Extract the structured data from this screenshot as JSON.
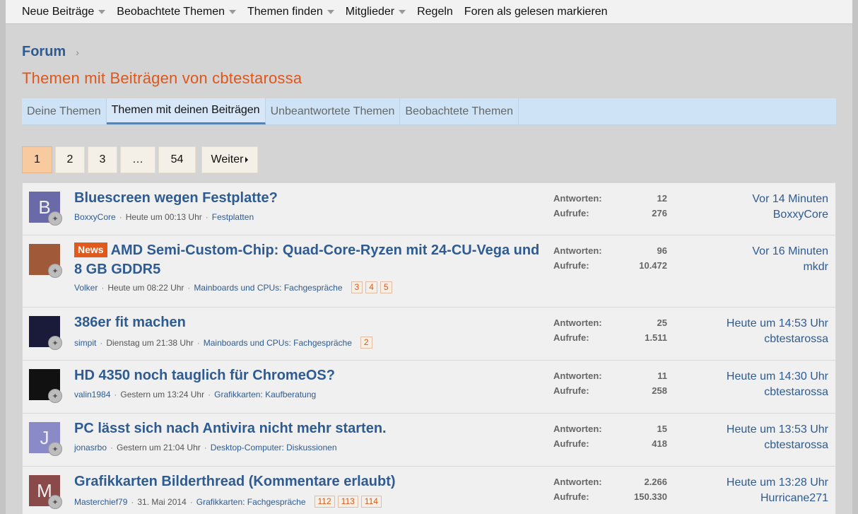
{
  "nav": {
    "items": [
      {
        "label": "Neue Beiträge",
        "caret": true
      },
      {
        "label": "Beobachtete Themen",
        "caret": true
      },
      {
        "label": "Themen finden",
        "caret": true
      },
      {
        "label": "Mitglieder",
        "caret": true
      },
      {
        "label": "Regeln",
        "caret": false
      },
      {
        "label": "Foren als gelesen markieren",
        "caret": false
      }
    ]
  },
  "breadcrumb": {
    "root": "Forum",
    "separator": "›"
  },
  "page_title": "Themen mit Beiträgen von cbtestarossa",
  "tabs": [
    {
      "label": "Deine Themen",
      "active": false
    },
    {
      "label": "Themen mit deinen Beiträgen",
      "active": true
    },
    {
      "label": "Unbeantwortete Themen",
      "active": false
    },
    {
      "label": "Beobachtete Themen",
      "active": false
    }
  ],
  "pagination": {
    "pages": [
      "1",
      "2",
      "3",
      "…",
      "54"
    ],
    "current": "1",
    "next_label": "Weiter"
  },
  "labels": {
    "replies": "Antworten:",
    "views": "Aufrufe:"
  },
  "threads": [
    {
      "title": "Bluescreen wegen Festplatte?",
      "prefix": "",
      "avatar_letter": "B",
      "avatar_color": "#6a6aa8",
      "author": "BoxxyCore",
      "date": "Heute um 00:13 Uhr",
      "forum": "Festplatten",
      "pages": [],
      "replies": "12",
      "views": "276",
      "last_time": "Vor 14 Minuten",
      "last_user": "BoxxyCore"
    },
    {
      "title": "AMD Semi-Custom-Chip: Quad-Core-Ryzen mit 24-CU-Vega und 8 GB GDDR5",
      "prefix": "News",
      "avatar_letter": "",
      "avatar_color": "#a05a3a",
      "author": "Volker",
      "date": "Heute um 08:22 Uhr",
      "forum": "Mainboards und CPUs: Fachgespräche",
      "pages": [
        "3",
        "4",
        "5"
      ],
      "replies": "96",
      "views": "10.472",
      "last_time": "Vor 16 Minuten",
      "last_user": "mkdr"
    },
    {
      "title": "386er fit machen",
      "prefix": "",
      "avatar_letter": "",
      "avatar_color": "#1a1a3a",
      "author": "simpit",
      "date": "Dienstag um 21:38 Uhr",
      "forum": "Mainboards und CPUs: Fachgespräche",
      "pages": [
        "2"
      ],
      "replies": "25",
      "views": "1.511",
      "last_time": "Heute um 14:53 Uhr",
      "last_user": "cbtestarossa"
    },
    {
      "title": "HD 4350 noch tauglich für ChromeOS?",
      "prefix": "",
      "avatar_letter": "",
      "avatar_color": "#111111",
      "author": "valin1984",
      "date": "Gestern um 13:24 Uhr",
      "forum": "Grafikkarten: Kaufberatung",
      "pages": [],
      "replies": "11",
      "views": "258",
      "last_time": "Heute um 14:30 Uhr",
      "last_user": "cbtestarossa"
    },
    {
      "title": "PC lässt sich nach Antivira nicht mehr starten.",
      "prefix": "",
      "avatar_letter": "J",
      "avatar_color": "#8a8ac8",
      "author": "jonasrbo",
      "date": "Gestern um 21:04 Uhr",
      "forum": "Desktop-Computer: Diskussionen",
      "pages": [],
      "replies": "15",
      "views": "418",
      "last_time": "Heute um 13:53 Uhr",
      "last_user": "cbtestarossa"
    },
    {
      "title": "Grafikkarten Bilderthread (Kommentare erlaubt)",
      "prefix": "",
      "avatar_letter": "M",
      "avatar_color": "#8a4a4a",
      "author": "Masterchief79",
      "date": "31. Mai 2014",
      "forum": "Grafikkarten: Fachgespräche",
      "pages": [
        "112",
        "113",
        "114"
      ],
      "replies": "2.266",
      "views": "150.330",
      "last_time": "Heute um 13:28 Uhr",
      "last_user": "Hurricane271"
    }
  ]
}
